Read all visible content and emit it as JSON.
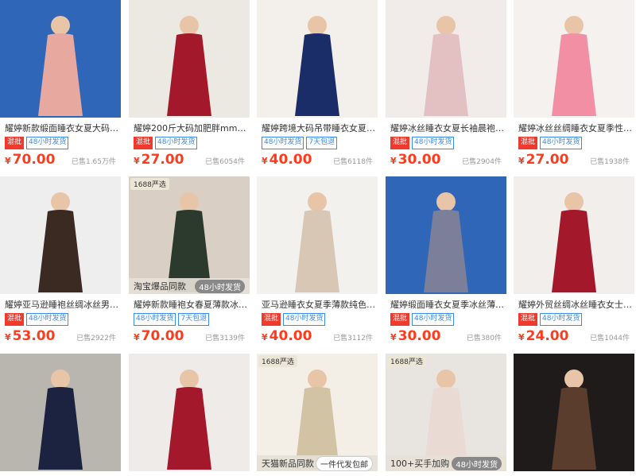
{
  "colors": {
    "price": "#ff3b1d",
    "tag_blue": "#3b8bf5",
    "tag_red": "#f03a2e"
  },
  "products": [
    {
      "title": "耀婷新款缎面睡衣女夏大码轻奢...",
      "tags": [
        {
          "text": "混批",
          "style": "red"
        },
        {
          "text": "48小时发货",
          "style": "blue"
        }
      ],
      "currency": "¥",
      "price": "70.00",
      "sold": "已售1.65万件",
      "bg": "#2f66b8",
      "fig": "#e7a8a0"
    },
    {
      "title": "耀婷200斤大码加肥胖mm春夏...",
      "tags": [
        {
          "text": "混批",
          "style": "red"
        },
        {
          "text": "48小时发货",
          "style": "blue"
        }
      ],
      "currency": "¥",
      "price": "27.00",
      "sold": "已售6054件",
      "bg": "#ece8e2",
      "fig": "#a3182b"
    },
    {
      "title": "耀婷跨境大码吊带睡衣女夏女士...",
      "tags": [
        {
          "text": "48小时发货",
          "style": "blue"
        },
        {
          "text": "7天包退",
          "style": "blue"
        }
      ],
      "currency": "¥",
      "price": "40.00",
      "sold": "已售6118件",
      "bg": "#f3efea",
      "fig": "#1b2d68"
    },
    {
      "title": "耀婷冰丝睡衣女夏长袖晨袍缎面...",
      "tags": [
        {
          "text": "混批",
          "style": "red"
        },
        {
          "text": "48小时发货",
          "style": "blue"
        }
      ],
      "currency": "¥",
      "price": "30.00",
      "sold": "已售2904件",
      "bg": "#f1ecea",
      "fig": "#e3c0c2"
    },
    {
      "title": "耀婷冰丝丝绸睡衣女夏季性感短...",
      "tags": [
        {
          "text": "混批",
          "style": "red"
        },
        {
          "text": "48小时发货",
          "style": "blue"
        }
      ],
      "currency": "¥",
      "price": "27.00",
      "sold": "已售1938件",
      "bg": "#f4f1ef",
      "fig": "#f28fa4"
    },
    {
      "title": "耀婷亚马逊睡袍丝绸冰丝男士睡...",
      "tags": [
        {
          "text": "混批",
          "style": "red"
        },
        {
          "text": "48小时发货",
          "style": "blue"
        }
      ],
      "currency": "¥",
      "price": "53.00",
      "sold": "已售2922件",
      "bg": "#eeeeee",
      "fig": "#3a2a22"
    },
    {
      "title": "耀婷新款睡袍女春夏薄款冰丝...",
      "tags": [
        {
          "text": "48小时发货",
          "style": "blue"
        },
        {
          "text": "7天包退",
          "style": "blue"
        }
      ],
      "currency": "¥",
      "price": "70.00",
      "sold": "已售3139件",
      "bg": "#d9cfc4",
      "fig": "#2b3a2c",
      "badge": "1688严选",
      "overlay_left": "淘宝爆品同款",
      "overlay_right": "48小时发货"
    },
    {
      "title": "亚马逊睡衣女夏季薄款纯色基础...",
      "tags": [
        {
          "text": "混批",
          "style": "red"
        },
        {
          "text": "48小时发货",
          "style": "blue"
        }
      ],
      "currency": "¥",
      "price": "40.00",
      "sold": "已售3112件",
      "bg": "#f3f1ee",
      "fig": "#d8c7b4"
    },
    {
      "title": "耀婷缎面睡衣女夏季冰丝薄款睡...",
      "tags": [
        {
          "text": "混批",
          "style": "red"
        },
        {
          "text": "48小时发货",
          "style": "blue"
        }
      ],
      "currency": "¥",
      "price": "30.00",
      "sold": "已售380件",
      "bg": "#2f66b8",
      "fig": "#7c7f99"
    },
    {
      "title": "耀婷外贸丝绸冰丝睡衣女士春夏...",
      "tags": [
        {
          "text": "混批",
          "style": "red"
        },
        {
          "text": "48小时发货",
          "style": "blue"
        }
      ],
      "currency": "¥",
      "price": "24.00",
      "sold": "已售1044件",
      "bg": "#f1eeec",
      "fig": "#a3182b"
    },
    {
      "title": "",
      "tags": [],
      "currency": "",
      "price": "",
      "sold": "",
      "bg": "#b9b6b0",
      "fig": "#1c2340"
    },
    {
      "title": "",
      "tags": [],
      "currency": "",
      "price": "",
      "sold": "",
      "bg": "#eeebe8",
      "fig": "#a3182b"
    },
    {
      "title": "",
      "tags": [],
      "currency": "",
      "price": "",
      "sold": "",
      "bg": "#f3efe6",
      "fig": "#d2c3a5",
      "badge": "1688严选",
      "overlay_left": "天猫新品同款",
      "overlay_right": "一件代发包邮"
    },
    {
      "title": "",
      "tags": [],
      "currency": "",
      "price": "",
      "sold": "",
      "bg": "#e8e5e0",
      "fig": "#eadad4",
      "badge": "1688严选",
      "overlay_left": "100+买手加购",
      "overlay_right": "48小时发货"
    },
    {
      "title": "",
      "tags": [],
      "currency": "",
      "price": "",
      "sold": "",
      "bg": "#1f1b1a",
      "fig": "#5a3d2c"
    }
  ]
}
